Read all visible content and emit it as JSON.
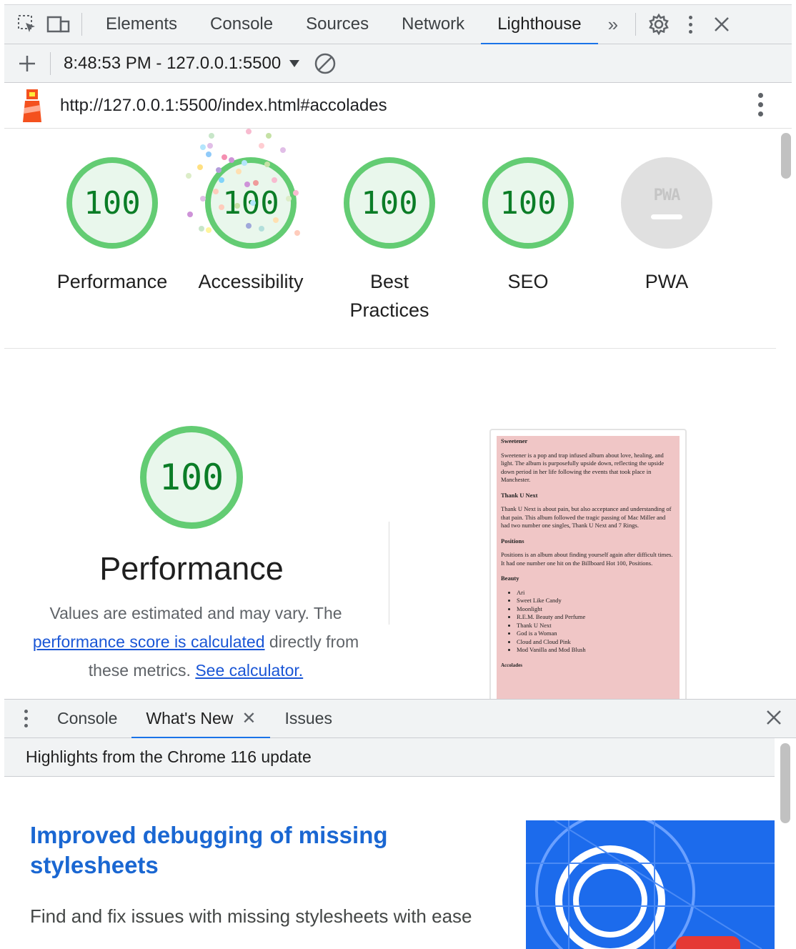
{
  "devtools": {
    "tabs": [
      {
        "label": "Elements"
      },
      {
        "label": "Console"
      },
      {
        "label": "Sources"
      },
      {
        "label": "Network"
      },
      {
        "label": "Lighthouse"
      }
    ],
    "active_tab": "Lighthouse",
    "more_tabs": "»",
    "accent_color": "#1a73e8"
  },
  "lighthouse": {
    "report_select": "8:48:53 PM - 127.0.0.1:5500",
    "url": "http://127.0.0.1:5500/index.html#accolades",
    "gauges": [
      {
        "score": "100",
        "label": "Performance"
      },
      {
        "score": "100",
        "label": "Accessibility"
      },
      {
        "score": "100",
        "label": "Best Practices"
      },
      {
        "score": "100",
        "label": "SEO"
      },
      {
        "score": "",
        "label": "PWA",
        "badge": "PWA"
      }
    ],
    "pass_color": "#0b7d27",
    "performance": {
      "score": "100",
      "title": "Performance",
      "desc_prefix": "Values are estimated and may vary. The",
      "desc_link": "performance score is calculated",
      "desc_mid": "directly from these metrics.",
      "desc_link2": "See calculator."
    },
    "screenshot": {
      "sections": [
        {
          "heading": "Sweetener",
          "text": "Sweetener is a pop and trap infused album about love, healing, and light. The album is purposefully upside down, reflecting the upside down period in her life following the events that took place in Manchester."
        },
        {
          "heading": "Thank U Next",
          "text": "Thank U Next is about pain, but also acceptance and understanding of that pain. This album followed the tragic passing of Mac Miller and had two number one singles, Thank U Next and 7 Rings."
        },
        {
          "heading": "Positions",
          "text": "Positions is an album about finding yourself again after difficult times. It had one number one hit on the Billboard Hot 100, Positions."
        }
      ],
      "beauty_heading": "Beauty",
      "beauty_items": [
        "Ari",
        "Sweet Like Candy",
        "Moonlight",
        "R.E.M. Beauty and Perfume",
        "Thank U Next",
        "God is a Woman",
        "Cloud and Cloud Pink",
        "Mod Vanilla and Mod Blush"
      ],
      "last_heading": "Accolades"
    }
  },
  "drawer": {
    "tabs": [
      {
        "label": "Console"
      },
      {
        "label": "What's New"
      },
      {
        "label": "Issues"
      }
    ],
    "whatsnew_header": "Highlights from the Chrome 116 update",
    "article_title": "Improved debugging of missing stylesheets",
    "article_body": "Find and fix issues with missing stylesheets with ease"
  }
}
